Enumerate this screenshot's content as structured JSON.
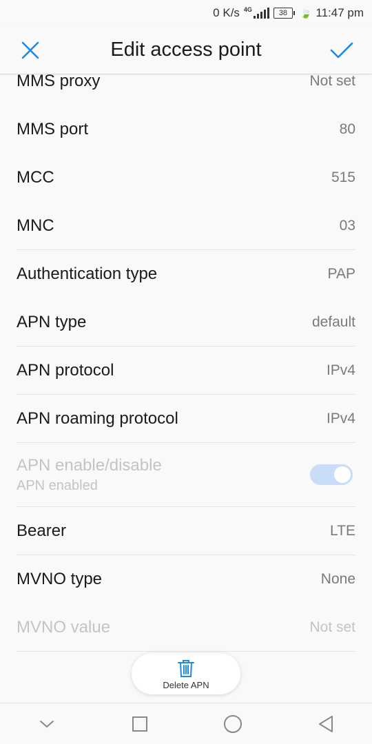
{
  "status_bar": {
    "speed": "0 K/s",
    "network": "4G",
    "battery": "38",
    "time": "11:47 pm"
  },
  "app_bar": {
    "title": "Edit access point",
    "close_icon": "close-icon",
    "confirm_icon": "check-icon",
    "accent_color": "#1e88e5"
  },
  "rows": [
    {
      "label": "MMS proxy",
      "value": "Not set"
    },
    {
      "label": "MMS port",
      "value": "80"
    },
    {
      "label": "MCC",
      "value": "515"
    },
    {
      "label": "MNC",
      "value": "03"
    },
    {
      "label": "Authentication type",
      "value": "PAP"
    },
    {
      "label": "APN type",
      "value": "default"
    },
    {
      "label": "APN protocol",
      "value": "IPv4"
    },
    {
      "label": "APN roaming protocol",
      "value": "IPv4"
    }
  ],
  "apn_toggle": {
    "label": "APN enable/disable",
    "sub": "APN enabled",
    "enabled": true,
    "disabled_state": true
  },
  "rows2": [
    {
      "label": "Bearer",
      "value": "LTE"
    },
    {
      "label": "MVNO type",
      "value": "None"
    }
  ],
  "mvno_value": {
    "label": "MVNO value",
    "value": "Not set"
  },
  "fab": {
    "label": "Delete APN",
    "icon": "trash-icon"
  },
  "nav": {
    "icons": [
      "chevron-down-icon",
      "square-icon",
      "circle-icon",
      "back-triangle-icon"
    ]
  }
}
